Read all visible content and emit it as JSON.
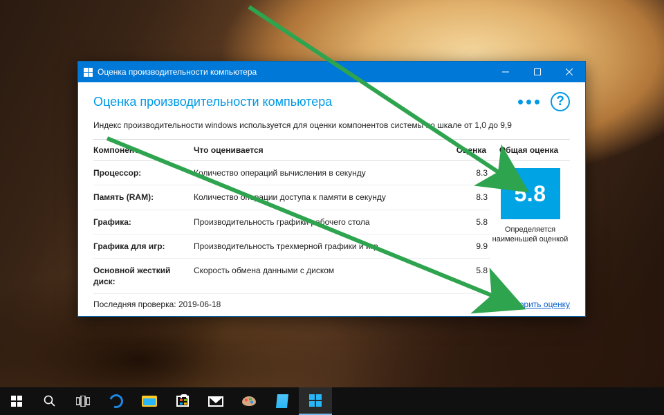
{
  "window": {
    "title": "Оценка производительности компьютера",
    "page_title": "Оценка производительности компьютера",
    "intro": "Индекс производительности windows используется для оценки компонентов системы по шкале от 1,0 до 9,9",
    "help_symbol": "?"
  },
  "columns": {
    "component": "Компонент",
    "description": "Что оценивается",
    "score": "Оценка",
    "overall": "Общая оценка"
  },
  "rows": [
    {
      "component": "Процессор:",
      "description": "Количество операций вычисления в секунду",
      "score": "8.3"
    },
    {
      "component": "Память (RAM):",
      "description": "Количество операции доступа к памяти в секунду",
      "score": "8.3"
    },
    {
      "component": "Графика:",
      "description": "Производительность графики рабочего стола",
      "score": "5.8"
    },
    {
      "component": "Графика для игр:",
      "description": "Производительность трехмерной графики и игр",
      "score": "9.9"
    },
    {
      "component": "Основной жесткий диск:",
      "description": "Скорость обмена данными с диском",
      "score": "5.8"
    }
  ],
  "overall": {
    "score": "5.8",
    "caption": "Определяется наименьшей оценкой"
  },
  "footer": {
    "last_check_label": "Последняя проверка:",
    "last_check_date": "2019-06-18",
    "repeat_link": "Повторить оценку"
  },
  "colors": {
    "accent": "#0078d7",
    "score_box": "#00a4e4",
    "arrow": "#2ea44f"
  }
}
